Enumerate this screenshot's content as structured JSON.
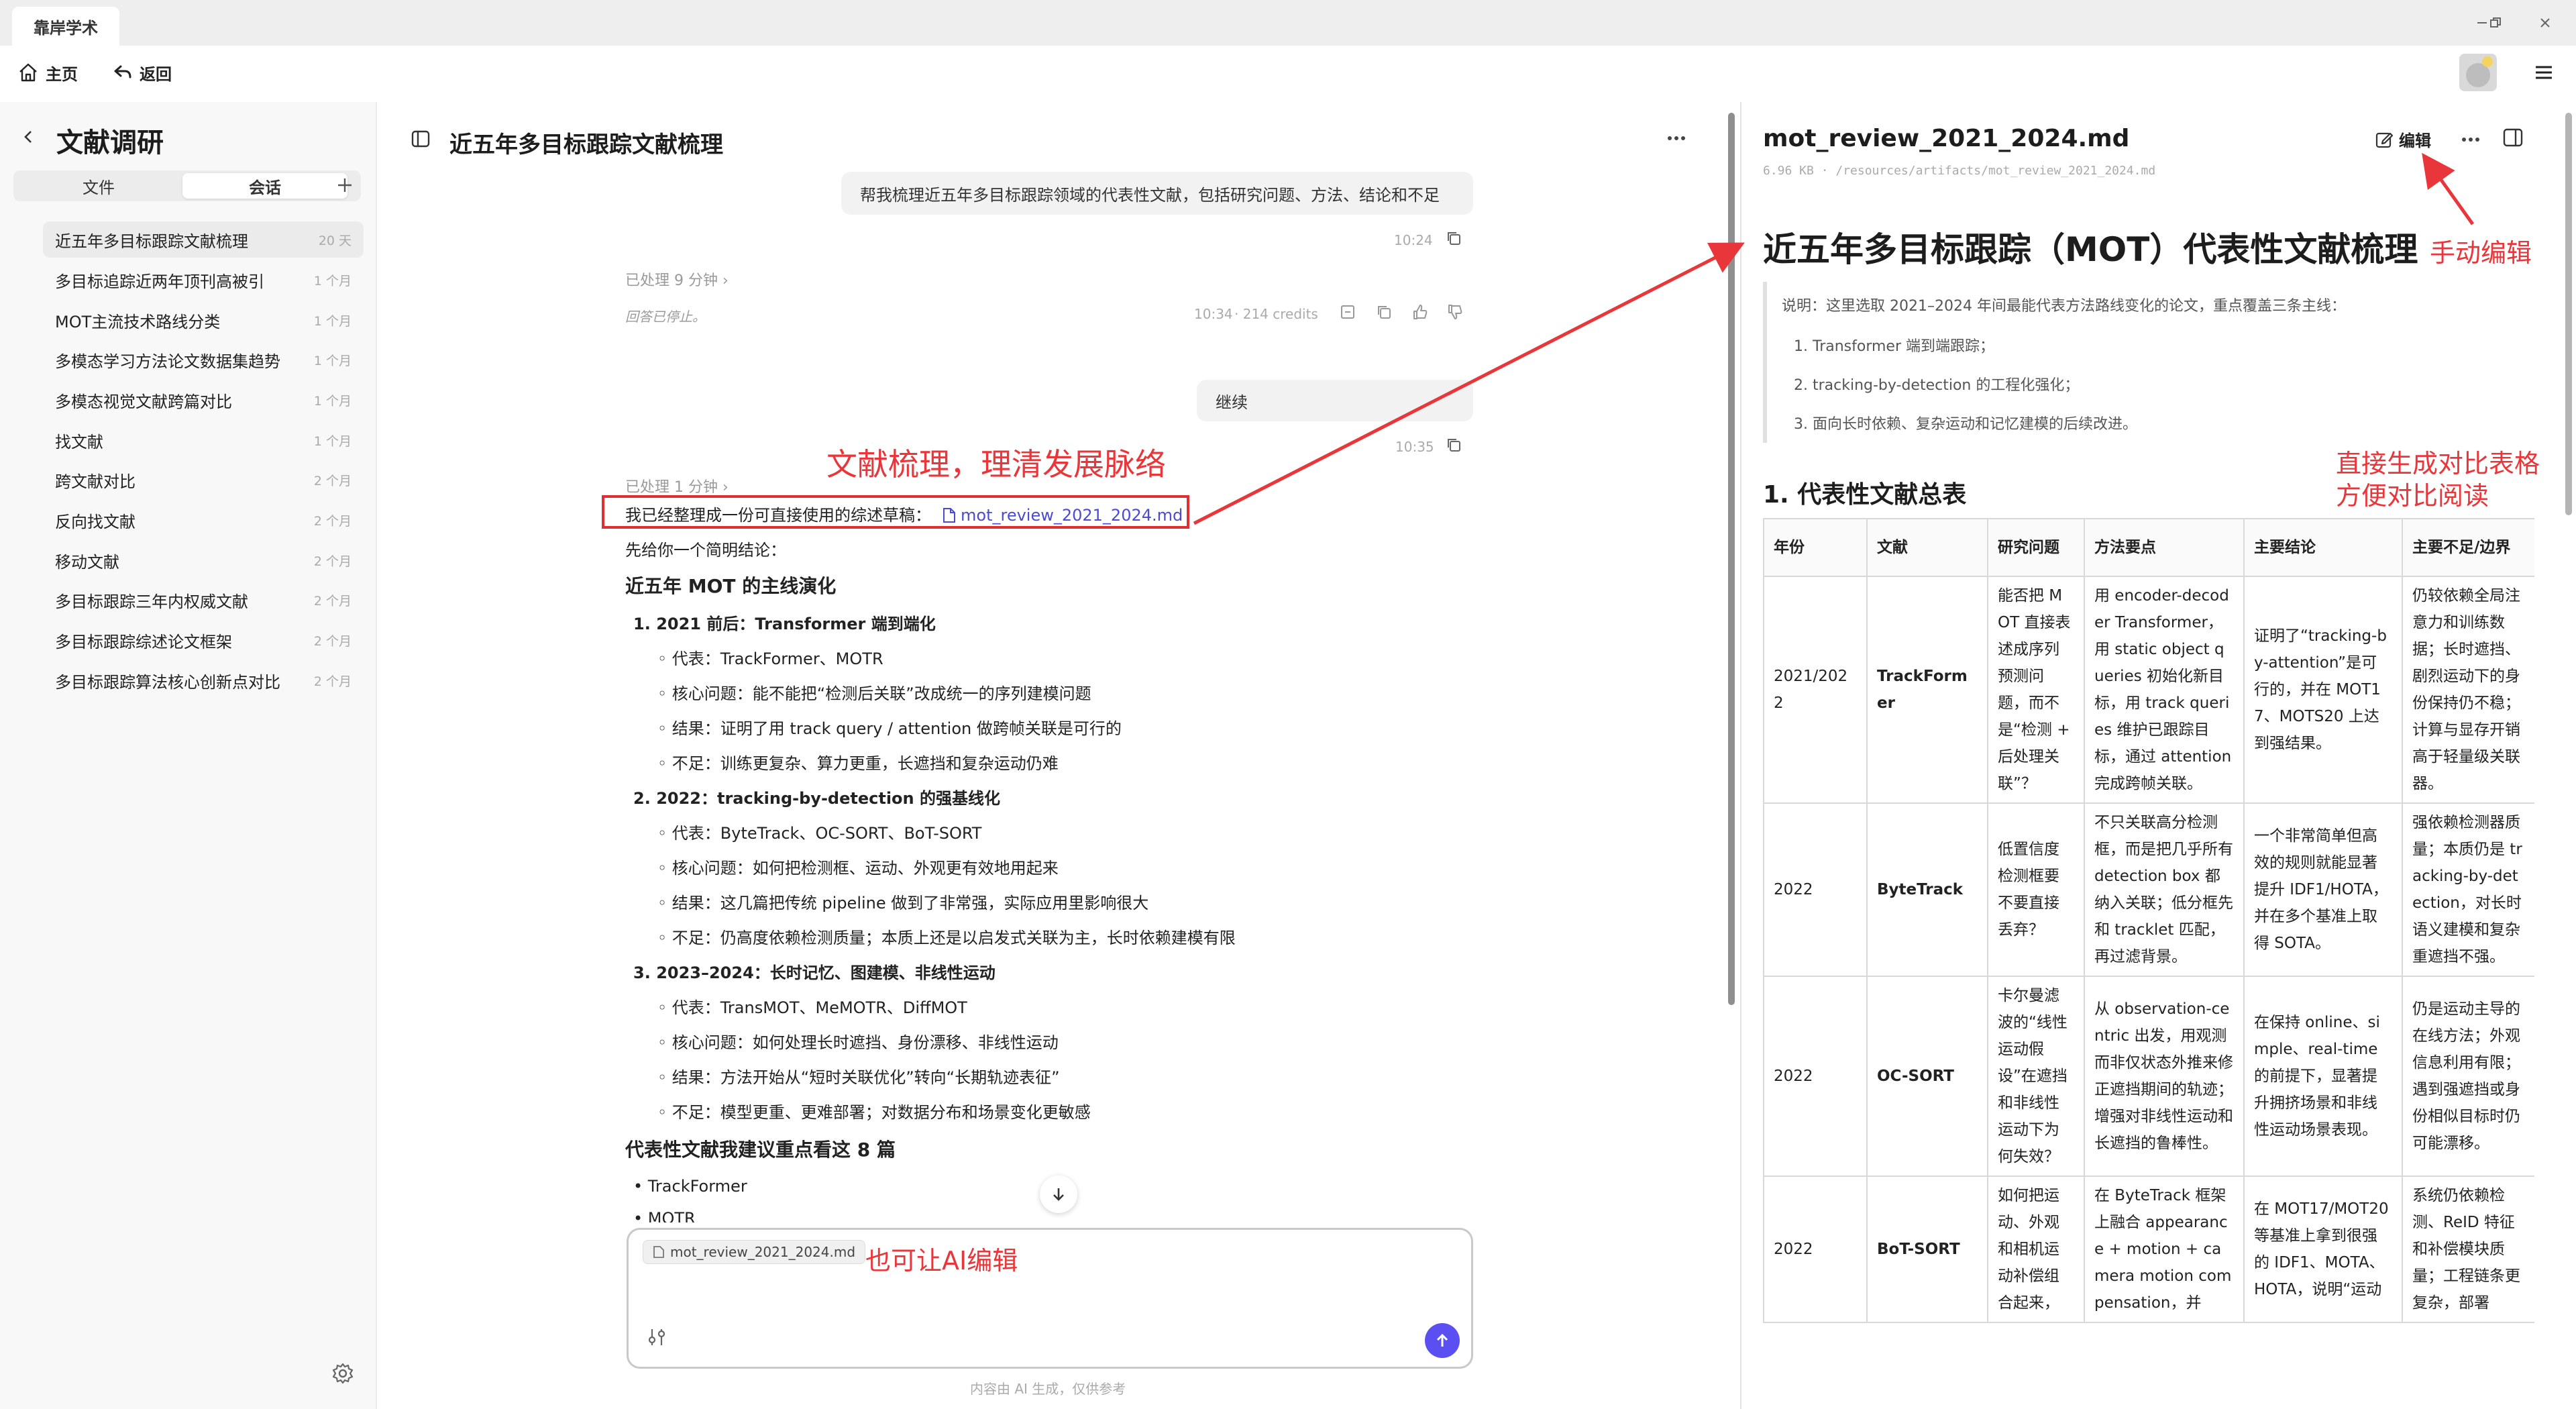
{
  "app": {
    "tab_title": "靠岸学术"
  },
  "toolbar": {
    "home_label": "主页",
    "back_label": "返回"
  },
  "sidebar": {
    "title": "文献调研",
    "tabs": [
      {
        "label": "文件"
      },
      {
        "label": "会话"
      }
    ],
    "items": [
      {
        "label": "近五年多目标跟踪文献梳理",
        "age": "20 天"
      },
      {
        "label": "多目标追踪近两年顶刊高被引",
        "age": "1 个月"
      },
      {
        "label": "MOT主流技术路线分类",
        "age": "1 个月"
      },
      {
        "label": "多模态学习方法论文数据集趋势",
        "age": "1 个月"
      },
      {
        "label": "多模态视觉文献跨篇对比",
        "age": "1 个月"
      },
      {
        "label": "找文献",
        "age": "1 个月"
      },
      {
        "label": "跨文献对比",
        "age": "2 个月"
      },
      {
        "label": "反向找文献",
        "age": "2 个月"
      },
      {
        "label": "移动文献",
        "age": "2 个月"
      },
      {
        "label": "多目标跟踪三年内权威文献",
        "age": "2 个月"
      },
      {
        "label": "多目标跟踪综述论文框架",
        "age": "2 个月"
      },
      {
        "label": "多目标跟踪算法核心创新点对比",
        "age": "2 个月"
      }
    ]
  },
  "chat": {
    "title": "近五年多目标跟踪文献梳理",
    "user_msg_1": "帮我梳理近五年多目标跟踪领域的代表性文献，包括研究问题、方法、结论和不足",
    "time_1": "10:24",
    "processed_1": "已处理 9 分钟",
    "stopped": "回答已停止。",
    "time_2": "10:34",
    "credits": "214 credits",
    "user_msg_2": "继续",
    "time_3": "10:35",
    "processed_2": "已处理 1 分钟",
    "answer_intro": "我已经整理成一份可直接使用的综述草稿：",
    "file_link": "mot_review_2021_2024.md",
    "conclusion_intro": "先给你一个简明结论：",
    "section_title": "近五年 MOT 的主线演化",
    "stages": [
      {
        "num": "1.",
        "title": "2021 前后：Transformer 端到端化",
        "bullets": [
          "代表：TrackFormer、MOTR",
          "核心问题：能不能把“检测后关联”改成统一的序列建模问题",
          "结果：证明了用 track query / attention 做跨帧关联是可行的",
          "不足：训练更复杂、算力更重，长遮挡和复杂运动仍难"
        ]
      },
      {
        "num": "2.",
        "title": "2022：tracking-by-detection 的强基线化",
        "bullets": [
          "代表：ByteTrack、OC-SORT、BoT-SORT",
          "核心问题：如何把检测框、运动、外观更有效地用起来",
          "结果：这几篇把传统 pipeline 做到了非常强，实际应用里影响很大",
          "不足：仍高度依赖检测质量；本质上还是以启发式关联为主，长时依赖建模有限"
        ]
      },
      {
        "num": "3.",
        "title": "2023–2024：长时记忆、图建模、非线性运动",
        "bullets": [
          "代表：TransMOT、MeMOTR、DiffMOT",
          "核心问题：如何处理长时遮挡、身份漂移、非线性运动",
          "结果：方法开始从“短时关联优化”转向“长期轨迹表征”",
          "不足：模型更重、更难部署；对数据分布和场景变化更敏感"
        ]
      }
    ],
    "rec_title": "代表性文献我建议重点看这 8 篇",
    "rec_items": [
      "TrackFormer",
      "MOTR"
    ],
    "composer_chip": "mot_review_2021_2024.md",
    "disclaimer": "内容由 AI 生成，仅供参考"
  },
  "doc": {
    "filename": "mot_review_2021_2024.md",
    "meta": "6.96 KB · /resources/artifacts/mot_review_2021_2024.md",
    "edit_label": "编辑",
    "h1": "近五年多目标跟踪（MOT）代表性文献梳理",
    "quote_intro": "说明：这里选取 2021–2024 年间最能代表方法路线变化的论文，重点覆盖三条主线：",
    "quote_items": [
      "1. Transformer 端到端跟踪；",
      "2. tracking-by-detection 的工程化强化；",
      "3. 面向长时依赖、复杂运动和记忆建模的后续改进。"
    ],
    "h2": "1. 代表性文献总表",
    "table": {
      "headers": [
        "年份",
        "文献",
        "研究问题",
        "方法要点",
        "主要结论",
        "主要不足/边界"
      ],
      "rows": [
        [
          "2021/2022",
          "TrackFormer",
          "能否把 MOT 直接表述成序列预测问题，而不是“检测 + 后处理关联”？",
          "用 encoder-decoder Transformer，用 static object queries 初始化新目标，用 track queries 维护已跟踪目标，通过 attention 完成跨帧关联。",
          "证明了“tracking-by-attention”是可行的，并在 MOT17、MOTS20 上达到强结果。",
          "仍较依赖全局注意力和训练数据；长时遮挡、剧烈运动下的身份保持仍不稳；计算与显存开销高于轻量级关联器。"
        ],
        [
          "2022",
          "ByteTrack",
          "低置信度检测框要不要直接丢弃？",
          "不只关联高分检测框，而是把几乎所有 detection box 都纳入关联；低分框先和 tracklet 匹配，再过滤背景。",
          "一个非常简单但高效的规则就能显著提升 IDF1/HOTA，并在多个基准上取得 SOTA。",
          "强依赖检测器质量；本质仍是 tracking-by-detection，对长时语义建模和复杂重遮挡不强。"
        ],
        [
          "2022",
          "OC-SORT",
          "卡尔曼滤波的“线性运动假设”在遮挡和非线性运动下为何失效？",
          "从 observation-centric 出发，用观测而非仅状态外推来修正遮挡期间的轨迹；增强对非线性运动和长遮挡的鲁棒性。",
          "在保持 online、simple、real-time 的前提下，显著提升拥挤场景和非线性运动场景表现。",
          "仍是运动主导的在线方法；外观信息利用有限；遇到强遮挡或身份相似目标时仍可能漂移。"
        ],
        [
          "2022",
          "BoT-SORT",
          "如何把运动、外观和相机运动补偿组合起来，",
          "在 ByteTrack 框架上融合 appearance + motion + camera motion compensation，并",
          "在 MOT17/MOT20 等基准上拿到很强的 IDF1、MOTA、HOTA，说明“运动",
          "系统仍依赖检测、ReID 特征和补偿模块质量；工程链条更复杂，部署"
        ]
      ]
    }
  },
  "annotations": {
    "review_note": "文献梳理，理清发展脉络",
    "manual_edit": "手动编辑",
    "table_note_1": "直接生成对比表格",
    "table_note_2": "方便对比阅读",
    "ai_edit": "也可让AI编辑"
  },
  "colors": {
    "annotation": "#e8363a",
    "accent": "#5b4ff2",
    "link": "#4a4ad6"
  }
}
